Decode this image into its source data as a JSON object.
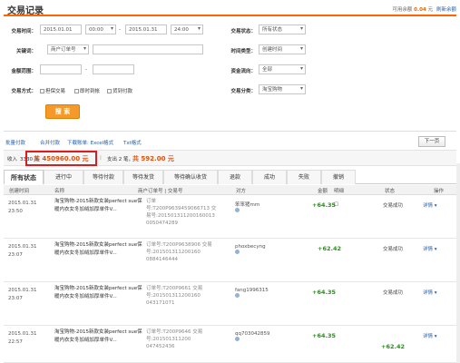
{
  "header": {
    "title": "交易记录",
    "balance_label": "可用余额",
    "balance_value": "0.04",
    "balance_unit": "元",
    "refresh": "刷新余额"
  },
  "filters": {
    "time_label": "交易时间：",
    "date_start": "2015.01.01",
    "hour_start": "00:00",
    "date_end": "2015.01.31",
    "hour_end": "24:00",
    "keyword_label": "关键词：",
    "keyword_type": "商户订单号",
    "amount_label": "金额范围：",
    "amount_sep": "-",
    "method_label": "交易方式：",
    "methods": [
      "担保交易",
      "即时到帐",
      "货到付款"
    ],
    "status_label": "交易状态：",
    "status_value": "所有状态",
    "time_type_label": "时间类型：",
    "time_type_value": "创建时间",
    "flow_label": "资金流向：",
    "flow_value": "全部",
    "category_label": "交易分类：",
    "category_value": "淘宝购物",
    "search_button": "搜 索"
  },
  "export_links": [
    "批量付款",
    "合并付款",
    "下载账单: Excel格式",
    "Txt格式"
  ],
  "next_page": "下一页",
  "summary": {
    "income_label": "收入",
    "income_count": "3330 笔",
    "income_amount": "共 450960.00 元",
    "sep": "|",
    "expense_label": "支出 2 笔，",
    "expense_amount": "共 592.00 元"
  },
  "tabs": [
    "所有状态",
    "进行中",
    "等待付款",
    "等待发货",
    "等待确认收货",
    "退款",
    "成功",
    "失败",
    "撤销"
  ],
  "columns": [
    "创建时间",
    "名称",
    "商户订单号 | 交易号",
    "对方",
    "金额",
    "明细",
    "状态",
    "操作"
  ],
  "rows": [
    {
      "date": "2015.01.31",
      "time": "23:50",
      "name": "淘宝购物-2015新款女装perfect sue保暖内衣女冬加绒加厚单件V...",
      "order": "订单号:T200P9639459066713 交易号:201501311200160013 0050474289",
      "party": "笨笨猪mm",
      "amount": "+64.35",
      "status": "交易成功",
      "op": "详情 ▾"
    },
    {
      "date": "2015.01.31",
      "time": "23:07",
      "name": "淘宝购物-2015新款女装perfect sue保暖内衣女冬加绒加厚单件V...",
      "order": "订单号:T200P9638906 交易号:201501311200160 0884146444",
      "party": "phoxbecyng",
      "amount": "+62.42",
      "status": "交易成功",
      "op": "详情 ▾"
    },
    {
      "date": "2015.01.31",
      "time": "23:07",
      "name": "淘宝购物-2015新款女装perfect sue保暖内衣女冬加绒加厚单件V...",
      "order": "订单号:T200P9661 交易号:201501311200160 043171071",
      "party": "fang1996315",
      "amount": "+64.35",
      "status": "交易成功",
      "op": "详情 ▾"
    },
    {
      "date": "2015.01.31",
      "time": "22:57",
      "name": "淘宝购物-2015新款女装perfect sue保暖内衣女冬加绒加厚单件V...",
      "order": "订单号:T200P9646 交易号:201501311200 047452436",
      "party": "qq703042859",
      "amount": "+64.35",
      "status": "交易成功",
      "op": "详情 ▾"
    }
  ],
  "extra_amount": "+62.42",
  "colors": {
    "accent": "#ff6600",
    "income": "#d9530f",
    "positive": "#2e8b22",
    "link": "#1e5eb2",
    "highlight_box": "#d81e1e"
  }
}
